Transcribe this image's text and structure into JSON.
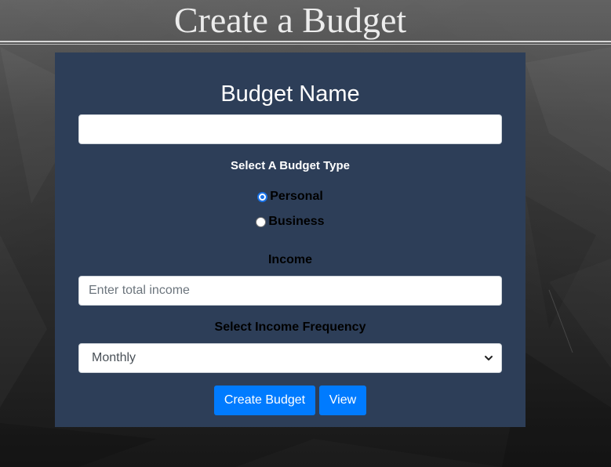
{
  "page": {
    "title": "Create a Budget"
  },
  "form": {
    "budget_name_heading": "Budget Name",
    "budget_name_value": "",
    "budget_type_heading": "Select A Budget Type",
    "budget_types": [
      {
        "label": "Personal",
        "checked": true
      },
      {
        "label": "Business",
        "checked": false
      }
    ],
    "income_heading": "Income",
    "income_placeholder": "Enter total income",
    "income_value": "",
    "frequency_heading": "Select Income Frequency",
    "frequency_selected": "Monthly",
    "create_button_label": "Create Budget",
    "view_button_label": "View"
  },
  "colors": {
    "card_background": "#2d3e58",
    "button_primary": "#007bff",
    "radio_checked": "#1a73e8",
    "title_text": "#ececec"
  },
  "icons": {
    "select_arrow": "chevron-down-icon"
  }
}
